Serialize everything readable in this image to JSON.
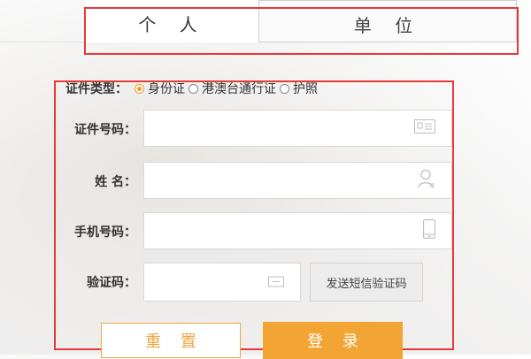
{
  "tabs": [
    {
      "label": "个 人",
      "active": true
    },
    {
      "label": "单 位",
      "active": false
    }
  ],
  "form": {
    "id_type": {
      "label": "证件类型：",
      "options": [
        {
          "label": "身份证",
          "checked": true
        },
        {
          "label": "港澳台通行证",
          "checked": false
        },
        {
          "label": "护照",
          "checked": false
        }
      ]
    },
    "id_number": {
      "label": "证件号码：",
      "value": "",
      "icon": "id-card-icon"
    },
    "name": {
      "label": "姓 名：",
      "value": "",
      "icon": "user-icon"
    },
    "phone": {
      "label": "手机号码：",
      "value": "",
      "icon": "phone-icon"
    },
    "captcha": {
      "label": "验证码：",
      "value": "",
      "icon": "keyboard-icon"
    },
    "sms_button": "发送短信验证码",
    "reset_button": "重 置",
    "login_button": "登 录"
  },
  "colors": {
    "accent": "#f2a532",
    "highlight_box": "#e53a3a"
  }
}
